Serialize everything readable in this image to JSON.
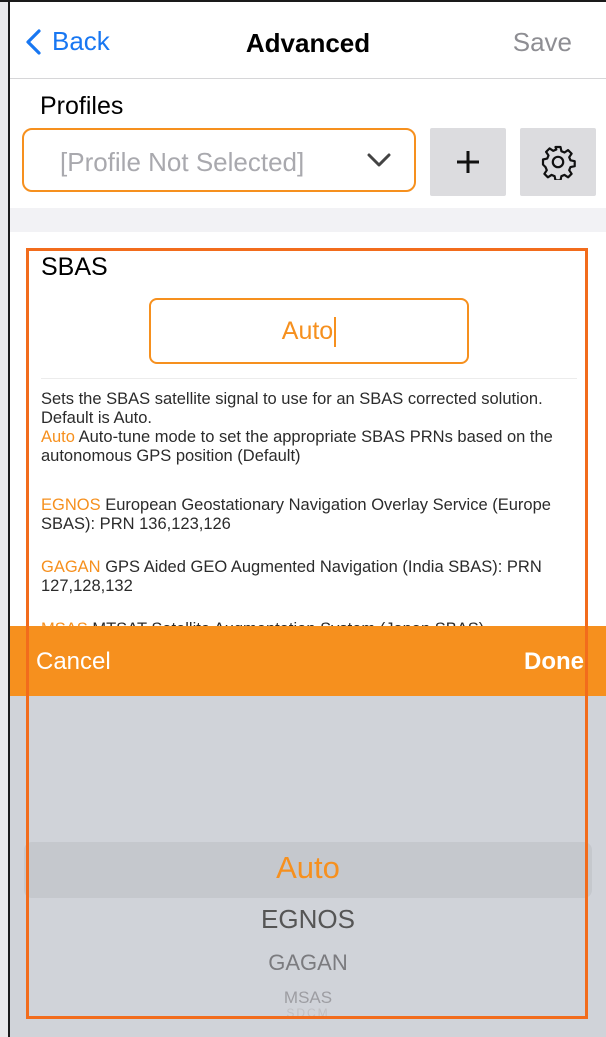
{
  "nav": {
    "back_label": "Back",
    "title": "Advanced",
    "save_label": "Save"
  },
  "profiles": {
    "label": "Profiles",
    "placeholder": "[Profile Not Selected]",
    "add_label": "+"
  },
  "sbas": {
    "title": "SBAS",
    "value": "Auto",
    "description": [
      {
        "hl": "",
        "text": "Sets the SBAS satellite signal to use for an SBAS corrected solution. Default is Auto."
      },
      {
        "hl": "Auto",
        "text": " Auto-tune mode to set the appropriate SBAS PRNs based on the autonomous GPS position (Default)"
      },
      {
        "hl": "EGNOS",
        "text": " European Geostationary Navigation Overlay Service (Europe SBAS): PRN 136,123,126"
      },
      {
        "hl": "GAGAN",
        "text": " GPS Aided GEO Augmented Navigation (India SBAS): PRN 127,128,132"
      },
      {
        "hl": "MSAS",
        "text": " MTSAT Satellite Augmentation System (Japan SBAS)"
      }
    ]
  },
  "picker": {
    "cancel_label": "Cancel",
    "done_label": "Done",
    "options": [
      "Auto",
      "EGNOS",
      "GAGAN",
      "MSAS",
      "SDCM"
    ],
    "selected": "Auto"
  },
  "colors": {
    "accent": "#f6901e",
    "link": "#1877f2",
    "overlay": "#f26c1c"
  }
}
